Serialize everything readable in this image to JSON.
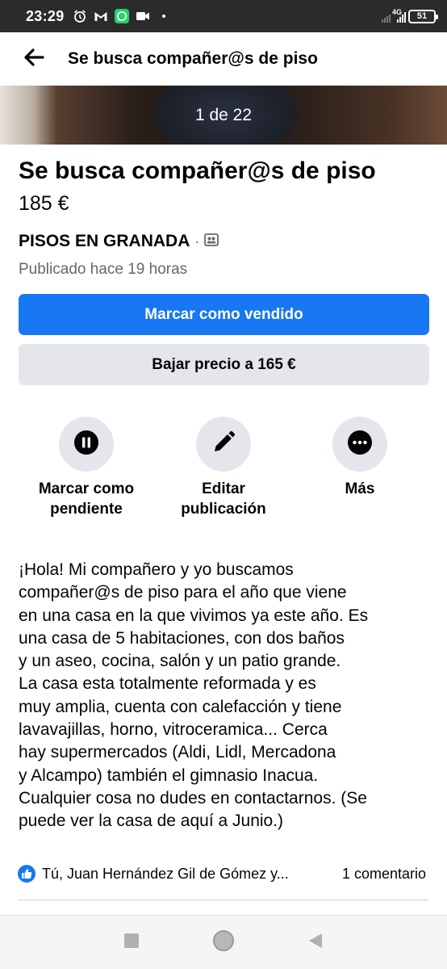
{
  "status_bar": {
    "time": "23:29",
    "network": "4G",
    "battery": "51"
  },
  "header": {
    "title": "Se busca compañer@s de piso"
  },
  "photo": {
    "counter": "1 de 22"
  },
  "listing": {
    "title": "Se busca compañer@s de piso",
    "price": "185 €",
    "group": "PISOS EN GRANADA",
    "group_separator": "·",
    "posted": "Publicado hace 19 horas"
  },
  "buttons": {
    "mark_sold": "Marcar como vendido",
    "lower_price": "Bajar precio a 165 €"
  },
  "actions": [
    {
      "label": "Marcar como\npendiente",
      "icon": "pause-icon"
    },
    {
      "label": "Editar\npublicación",
      "icon": "pencil-icon"
    },
    {
      "label": "Más",
      "icon": "more-icon"
    }
  ],
  "description": "¡Hola! Mi compañero y yo buscamos\ncompañer@s de piso para el año que viene\nen una casa en la que vivimos ya este año. Es\nuna casa de 5 habitaciones, con dos baños\ny un aseo, cocina, salón y un patio grande.\nLa casa esta totalmente reformada y es\nmuy amplia, cuenta con calefacción y tiene\nlavavajillas, horno, vitroceramica... Cerca\nhay supermercados (Aldi, Lidl, Mercadona\ny Alcampo) también el gimnasio Inacua.\nCualquier cosa no dudes en contactarnos. (Se\npuede ver la casa de aquí a Junio.)",
  "reactions": {
    "reactors": "Tú, Juan Hernández Gil de Gómez y...",
    "comments": "1 comentario"
  },
  "colors": {
    "accent": "#1877f2",
    "secondary_button": "#e4e6eb",
    "muted_text": "#65676b"
  }
}
